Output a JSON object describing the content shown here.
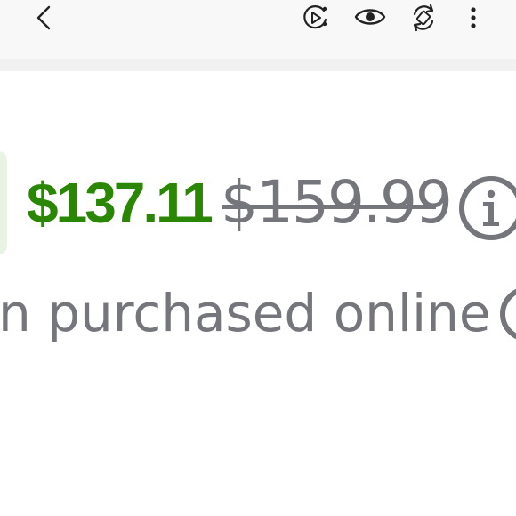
{
  "toolbar": {
    "icons": [
      "back-chevron-icon",
      "motion-photo-play-icon",
      "eye-icon",
      "rotate-auto-icon",
      "more-vertical-icon"
    ]
  },
  "product": {
    "sale_price": "$137.11",
    "original_price": "$159.99",
    "online_note": "n purchased online"
  },
  "colors": {
    "sale_green": "#2a8703",
    "muted_gray": "#74767c",
    "toolbar_bg": "#f8f8f8",
    "swatch_bg": "#e8f3e4"
  }
}
